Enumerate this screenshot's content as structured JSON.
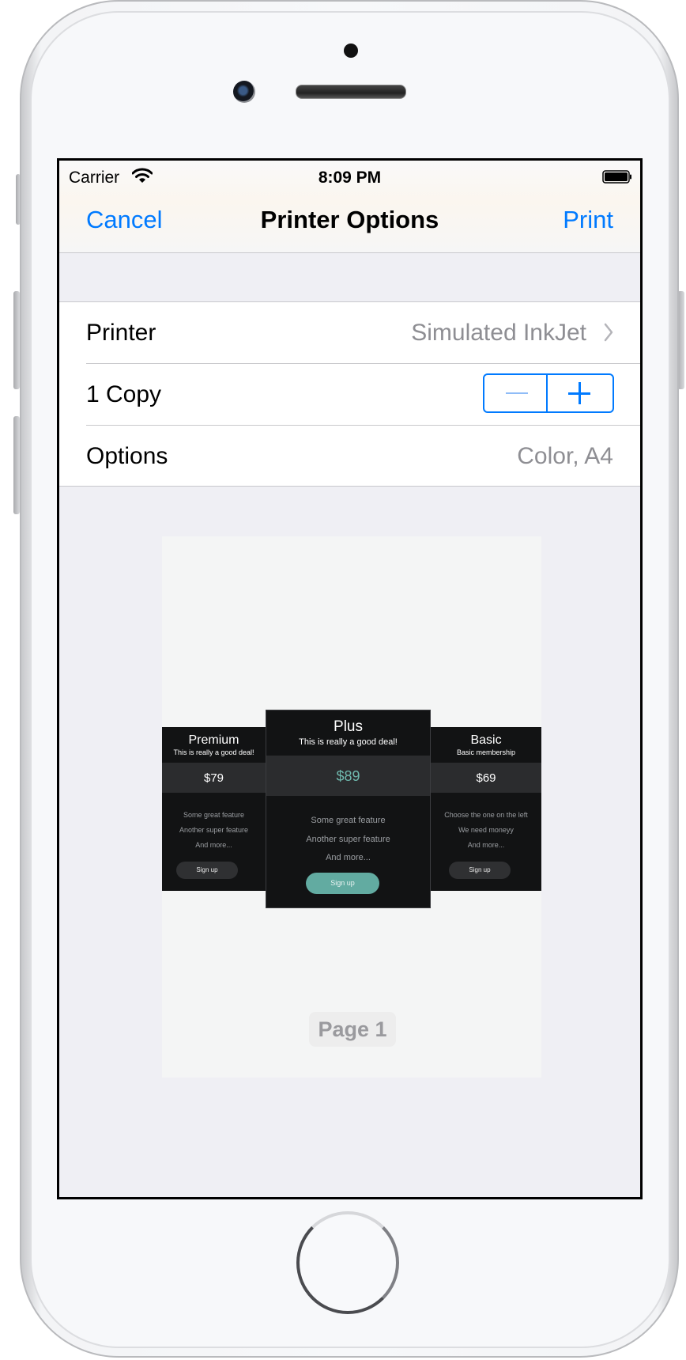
{
  "status_bar": {
    "carrier": "Carrier",
    "time": "8:09 PM"
  },
  "nav": {
    "cancel": "Cancel",
    "title": "Printer Options",
    "print": "Print"
  },
  "settings": {
    "printer_label": "Printer",
    "printer_value": "Simulated InkJet",
    "copies_label": "1 Copy",
    "options_label": "Options",
    "options_value": "Color, A4"
  },
  "preview": {
    "page_label": "Page 1",
    "plans": [
      {
        "name": "Premium",
        "subtitle": "This is really a good deal!",
        "price": "$79",
        "features": [
          "Some great feature",
          "Another super feature",
          "And more..."
        ],
        "button": "Sign up"
      },
      {
        "name": "Plus",
        "subtitle": "This is really a good deal!",
        "price": "$89",
        "features": [
          "Some great feature",
          "Another super feature",
          "And more..."
        ],
        "button": "Sign up"
      },
      {
        "name": "Basic",
        "subtitle": "Basic membership",
        "price": "$69",
        "features": [
          "Choose the one on the left",
          "We need moneyy",
          "And more..."
        ],
        "button": "Sign up"
      }
    ]
  },
  "colors": {
    "accent": "#007aff",
    "highlight": "#62aba1",
    "card_bg": "#121314"
  },
  "icons": [
    "wifi-icon",
    "battery-icon",
    "chevron-right-icon",
    "minus-icon",
    "plus-icon"
  ]
}
